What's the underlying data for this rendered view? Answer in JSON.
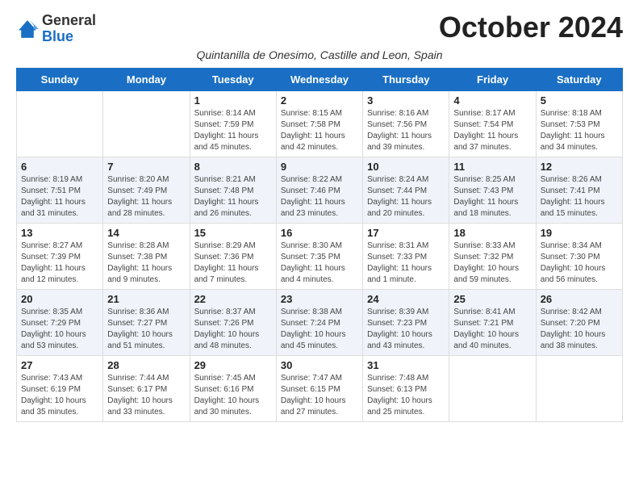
{
  "logo": {
    "general": "General",
    "blue": "Blue"
  },
  "header": {
    "month_title": "October 2024",
    "subtitle": "Quintanilla de Onesimo, Castille and Leon, Spain"
  },
  "days_of_week": [
    "Sunday",
    "Monday",
    "Tuesday",
    "Wednesday",
    "Thursday",
    "Friday",
    "Saturday"
  ],
  "weeks": [
    [
      {
        "day": "",
        "info": ""
      },
      {
        "day": "",
        "info": ""
      },
      {
        "day": "1",
        "info": "Sunrise: 8:14 AM\nSunset: 7:59 PM\nDaylight: 11 hours and 45 minutes."
      },
      {
        "day": "2",
        "info": "Sunrise: 8:15 AM\nSunset: 7:58 PM\nDaylight: 11 hours and 42 minutes."
      },
      {
        "day": "3",
        "info": "Sunrise: 8:16 AM\nSunset: 7:56 PM\nDaylight: 11 hours and 39 minutes."
      },
      {
        "day": "4",
        "info": "Sunrise: 8:17 AM\nSunset: 7:54 PM\nDaylight: 11 hours and 37 minutes."
      },
      {
        "day": "5",
        "info": "Sunrise: 8:18 AM\nSunset: 7:53 PM\nDaylight: 11 hours and 34 minutes."
      }
    ],
    [
      {
        "day": "6",
        "info": "Sunrise: 8:19 AM\nSunset: 7:51 PM\nDaylight: 11 hours and 31 minutes."
      },
      {
        "day": "7",
        "info": "Sunrise: 8:20 AM\nSunset: 7:49 PM\nDaylight: 11 hours and 28 minutes."
      },
      {
        "day": "8",
        "info": "Sunrise: 8:21 AM\nSunset: 7:48 PM\nDaylight: 11 hours and 26 minutes."
      },
      {
        "day": "9",
        "info": "Sunrise: 8:22 AM\nSunset: 7:46 PM\nDaylight: 11 hours and 23 minutes."
      },
      {
        "day": "10",
        "info": "Sunrise: 8:24 AM\nSunset: 7:44 PM\nDaylight: 11 hours and 20 minutes."
      },
      {
        "day": "11",
        "info": "Sunrise: 8:25 AM\nSunset: 7:43 PM\nDaylight: 11 hours and 18 minutes."
      },
      {
        "day": "12",
        "info": "Sunrise: 8:26 AM\nSunset: 7:41 PM\nDaylight: 11 hours and 15 minutes."
      }
    ],
    [
      {
        "day": "13",
        "info": "Sunrise: 8:27 AM\nSunset: 7:39 PM\nDaylight: 11 hours and 12 minutes."
      },
      {
        "day": "14",
        "info": "Sunrise: 8:28 AM\nSunset: 7:38 PM\nDaylight: 11 hours and 9 minutes."
      },
      {
        "day": "15",
        "info": "Sunrise: 8:29 AM\nSunset: 7:36 PM\nDaylight: 11 hours and 7 minutes."
      },
      {
        "day": "16",
        "info": "Sunrise: 8:30 AM\nSunset: 7:35 PM\nDaylight: 11 hours and 4 minutes."
      },
      {
        "day": "17",
        "info": "Sunrise: 8:31 AM\nSunset: 7:33 PM\nDaylight: 11 hours and 1 minute."
      },
      {
        "day": "18",
        "info": "Sunrise: 8:33 AM\nSunset: 7:32 PM\nDaylight: 10 hours and 59 minutes."
      },
      {
        "day": "19",
        "info": "Sunrise: 8:34 AM\nSunset: 7:30 PM\nDaylight: 10 hours and 56 minutes."
      }
    ],
    [
      {
        "day": "20",
        "info": "Sunrise: 8:35 AM\nSunset: 7:29 PM\nDaylight: 10 hours and 53 minutes."
      },
      {
        "day": "21",
        "info": "Sunrise: 8:36 AM\nSunset: 7:27 PM\nDaylight: 10 hours and 51 minutes."
      },
      {
        "day": "22",
        "info": "Sunrise: 8:37 AM\nSunset: 7:26 PM\nDaylight: 10 hours and 48 minutes."
      },
      {
        "day": "23",
        "info": "Sunrise: 8:38 AM\nSunset: 7:24 PM\nDaylight: 10 hours and 45 minutes."
      },
      {
        "day": "24",
        "info": "Sunrise: 8:39 AM\nSunset: 7:23 PM\nDaylight: 10 hours and 43 minutes."
      },
      {
        "day": "25",
        "info": "Sunrise: 8:41 AM\nSunset: 7:21 PM\nDaylight: 10 hours and 40 minutes."
      },
      {
        "day": "26",
        "info": "Sunrise: 8:42 AM\nSunset: 7:20 PM\nDaylight: 10 hours and 38 minutes."
      }
    ],
    [
      {
        "day": "27",
        "info": "Sunrise: 7:43 AM\nSunset: 6:19 PM\nDaylight: 10 hours and 35 minutes."
      },
      {
        "day": "28",
        "info": "Sunrise: 7:44 AM\nSunset: 6:17 PM\nDaylight: 10 hours and 33 minutes."
      },
      {
        "day": "29",
        "info": "Sunrise: 7:45 AM\nSunset: 6:16 PM\nDaylight: 10 hours and 30 minutes."
      },
      {
        "day": "30",
        "info": "Sunrise: 7:47 AM\nSunset: 6:15 PM\nDaylight: 10 hours and 27 minutes."
      },
      {
        "day": "31",
        "info": "Sunrise: 7:48 AM\nSunset: 6:13 PM\nDaylight: 10 hours and 25 minutes."
      },
      {
        "day": "",
        "info": ""
      },
      {
        "day": "",
        "info": ""
      }
    ]
  ],
  "colors": {
    "header_bg": "#1a6fc4",
    "header_text": "#ffffff",
    "border": "#cccccc",
    "row_even": "#f5f8fd",
    "row_odd": "#ffffff"
  }
}
